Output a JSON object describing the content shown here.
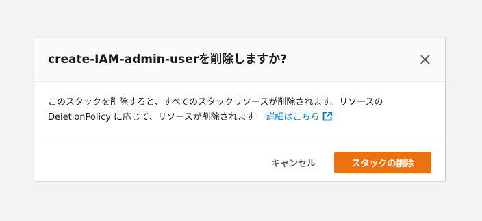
{
  "dialog": {
    "title": "create-IAM-admin-userを削除しますか?",
    "close_icon": "close-icon",
    "body_text": "このスタックを削除すると、すべてのスタックリソースが削除されます。リソースの DeletionPolicy に応じて、リソースが削除されます。",
    "learn_more_label": "詳細はこちら",
    "learn_more_icon": "external-link-icon",
    "cancel_label": "キャンセル",
    "delete_label": "スタックの削除"
  },
  "colors": {
    "primary_button": "#ec7211",
    "link": "#0073bb",
    "background": "#f2f3f3"
  }
}
